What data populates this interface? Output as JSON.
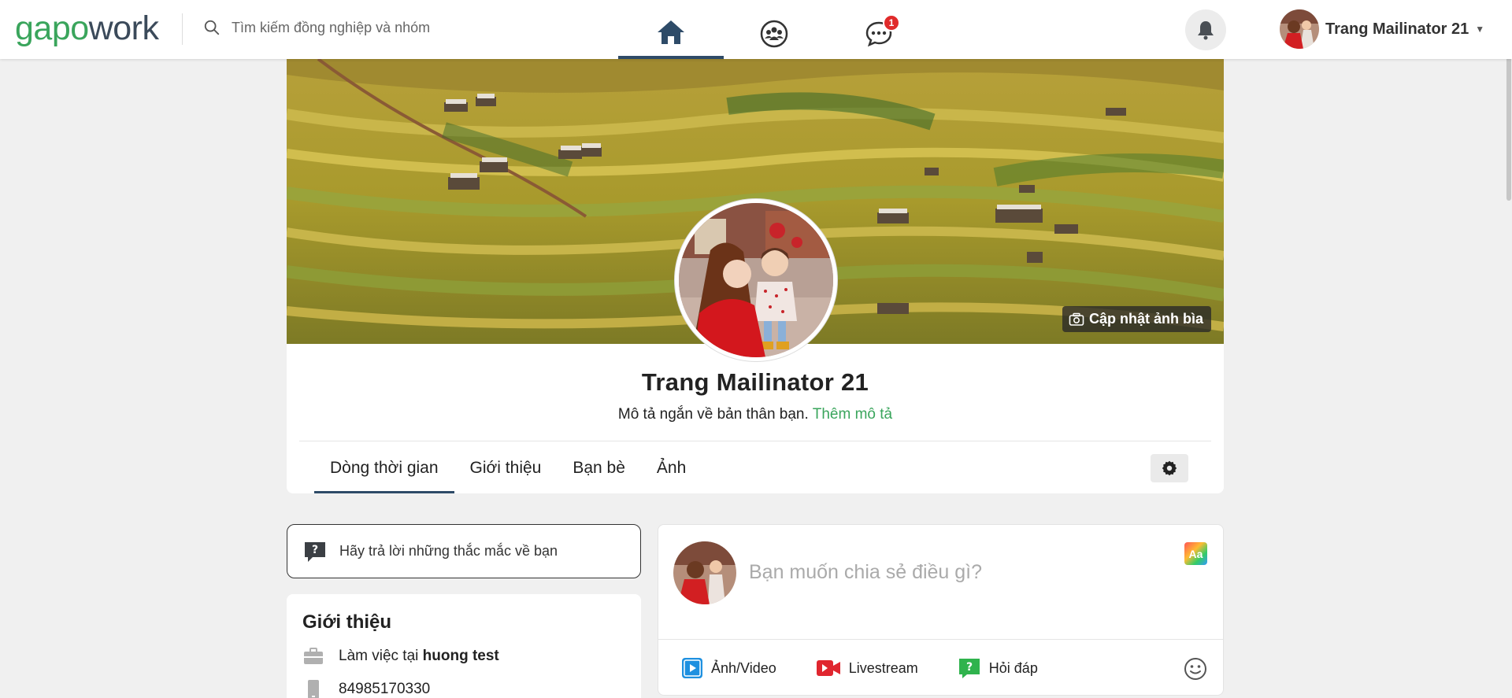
{
  "header": {
    "logo_part1": "gapo",
    "logo_part2": "work",
    "search_placeholder": "Tìm kiếm đồng nghiệp và nhóm",
    "chat_badge": "1",
    "user_name": "Trang Mailinator 21"
  },
  "profile": {
    "cover_button": "Cập nhật ảnh bìa",
    "name": "Trang Mailinator 21",
    "desc": "Mô tả ngắn về bản thân bạn.",
    "add_desc_link": "Thêm mô tả",
    "tabs": [
      "Dòng thời gian",
      "Giới thiệu",
      "Bạn bè",
      "Ảnh"
    ]
  },
  "sidebar": {
    "ask_prompt": "Hãy trả lời những thắc mắc về bạn",
    "intro_title": "Giới thiệu",
    "work_prefix": "Làm việc tại",
    "work_place": "huong test",
    "phone": "84985170330"
  },
  "composer": {
    "placeholder": "Bạn muốn chia sẻ điều gì?",
    "font_icon_text": "Aa",
    "actions": [
      "Ảnh/Video",
      "Livestream",
      "Hỏi đáp"
    ]
  },
  "colors": {
    "brand_green": "#3aa55c",
    "brand_dark": "#3b4a5a",
    "active_tab": "#2e4b68",
    "badge_red": "#e02a2a"
  }
}
